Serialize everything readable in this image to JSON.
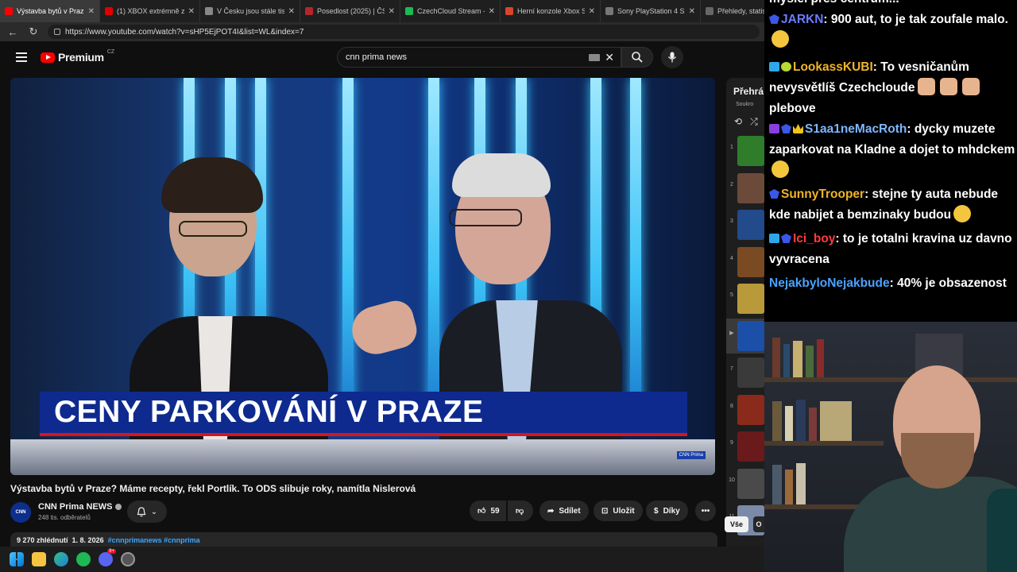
{
  "browser": {
    "tabs": [
      {
        "label": "Výstavba bytů v Praz",
        "active": true,
        "fav_color": "#ff0000"
      },
      {
        "label": "(1) XBOX extrémně zdra",
        "active": false,
        "fav_color": "#e00000"
      },
      {
        "label": "V Česku jsou stále tisíce",
        "active": false,
        "fav_color": "#888888"
      },
      {
        "label": "Posedlost (2025) | ČSFD",
        "active": false,
        "fav_color": "#b3262d"
      },
      {
        "label": "CzechCloud Stream - W",
        "active": false,
        "fav_color": "#1db954"
      },
      {
        "label": "Herní konzole Xbox Ser",
        "active": false,
        "fav_color": "#d8452a"
      },
      {
        "label": "Sony PlayStation 4 Slim",
        "active": false,
        "fav_color": "#777777"
      },
      {
        "label": "Přehledy, statisti",
        "active": false,
        "fav_color": "#666666"
      }
    ],
    "url": "https://www.youtube.com/watch?v=sHP5EjPOT4I&list=WL&index=7"
  },
  "youtube": {
    "logo_text": "Premium",
    "logo_country": "CZ",
    "search_value": "cnn prima news",
    "video": {
      "overlay_title": "CENY PARKOVÁNÍ V PRAZE",
      "watermark": "CNN Prima"
    },
    "title": "Výstavba bytů v Praze? Máme recepty, řekl Portlík. To ODS slibuje roky, namítla Nislerová",
    "channel": {
      "name": "CNN Prima NEWS",
      "subscribers": "248 tis. odběratelů",
      "avatar_text": "CNN"
    },
    "actions": {
      "likes": "59",
      "share": "Sdílet",
      "save": "Uložit",
      "thanks": "Díky"
    },
    "description": {
      "views": "9 270 zhlédnutí",
      "date": "1. 8. 2026",
      "hashtags": "#cnnprimanews #cnnprima"
    },
    "playlist": {
      "title": "Přehrá",
      "subtitle": "Soukro",
      "items": [
        {
          "num": "1",
          "color": "#2f7d2a"
        },
        {
          "num": "2",
          "color": "#6b4a3a"
        },
        {
          "num": "3",
          "color": "#234a8a"
        },
        {
          "num": "4",
          "color": "#7a4a22"
        },
        {
          "num": "5",
          "color": "#b89a3a"
        },
        {
          "num": "▶",
          "color": "#1c4fa8",
          "active": true
        },
        {
          "num": "7",
          "color": "#3a3a3a"
        },
        {
          "num": "8",
          "color": "#8a2a1a"
        },
        {
          "num": "9",
          "color": "#6a1a1a"
        },
        {
          "num": "10",
          "color": "#4a4a4a"
        },
        {
          "num": "11",
          "color": "#7a8aa8"
        }
      ],
      "see_all": "Vše",
      "see_all2": "O"
    }
  },
  "chat": {
    "top_fragment": "myslel přes centrum...",
    "messages": [
      {
        "user": "JARKN",
        "user_color": "#6b7cff",
        "badges": [
          "badge-blue"
        ],
        "text": ": 900 aut, to je tak zoufale malo.",
        "emote": "emote-grin"
      },
      {
        "user": "LookassKUBI",
        "user_color": "#f0b429",
        "badges": [
          "badge-cube",
          "badge-lime"
        ],
        "text": ": To vesničanům nevysvětlíš Czechcloude",
        "emote": "emote-face",
        "emote_count": 3,
        "tail": "plebove"
      },
      {
        "user": "S1aa1neMacRoth",
        "user_color": "#7fb7ff",
        "badges": [
          "badge-purple",
          "badge-blue",
          "badge-crown"
        ],
        "text": ": dycky muzete zaparkovat na Kladne a dojet to mhdckem",
        "emote": "emote-grin"
      },
      {
        "user": "SunnyTrooper",
        "user_color": "#f0b429",
        "badges": [
          "badge-blue"
        ],
        "text": ": stejne ty auta nebude kde nabijet a bemzinaky budou",
        "emote": "emote-grin"
      },
      {
        "user": "Ici_boy",
        "user_color": "#ff3b3b",
        "badges": [
          "badge-cube",
          "badge-blue"
        ],
        "text": ": to je totalni kravina uz davno vyvracena"
      },
      {
        "user": "NejakbyloNejakbude",
        "user_color": "#4aa3ff",
        "badges": [],
        "text": ": 40% je obsazenost"
      }
    ]
  }
}
